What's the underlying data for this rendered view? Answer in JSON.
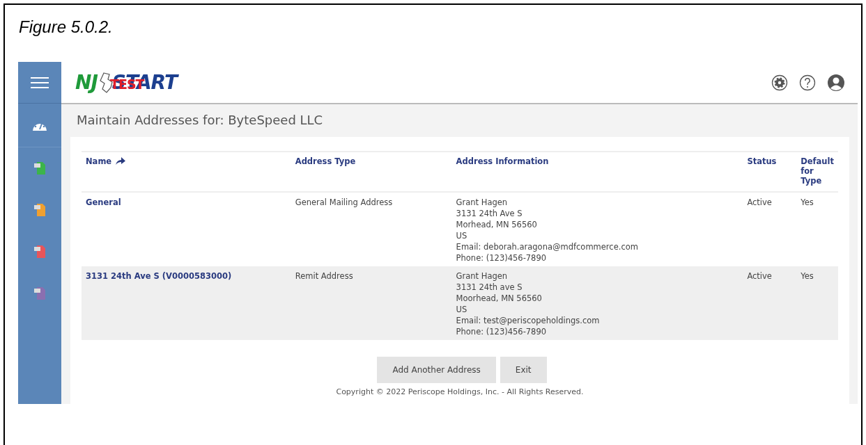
{
  "figure_caption": "Figure 5.0.2.",
  "logo": {
    "left": "NJ",
    "right": "START",
    "overlay": "TEST"
  },
  "page_title": "Maintain Addresses for:  ByteSpeed LLC",
  "table": {
    "columns": [
      {
        "label": "Name",
        "sorted": true
      },
      {
        "label": "Address Type",
        "sorted": false
      },
      {
        "label": "Address Information",
        "sorted": false
      },
      {
        "label": "Status",
        "sorted": false
      },
      {
        "label": "Default for Type",
        "sorted": false
      }
    ],
    "rows": [
      {
        "name": "General",
        "type": "General Mailing Address",
        "info": [
          "Grant Hagen",
          "3131 24th Ave S",
          "Morhead, MN 56560",
          "US",
          "Email: deborah.aragona@mdfcommerce.com",
          "Phone: (123)456-7890"
        ],
        "status": "Active",
        "default": "Yes"
      },
      {
        "name": "3131 24th Ave S (V0000583000)",
        "type": "Remit Address",
        "info": [
          "Grant Hagen",
          "3131 24th ave S",
          "Moorhead, MN 56560",
          "US",
          "Email: test@periscopeholdings.com",
          "Phone: (123)456-7890"
        ],
        "status": "Active",
        "default": "Yes"
      }
    ]
  },
  "buttons": [
    "Add Another Address",
    "Exit"
  ],
  "footer": "Copyright © 2022 Periscope Holdings, Inc. - All Rights Reserved."
}
